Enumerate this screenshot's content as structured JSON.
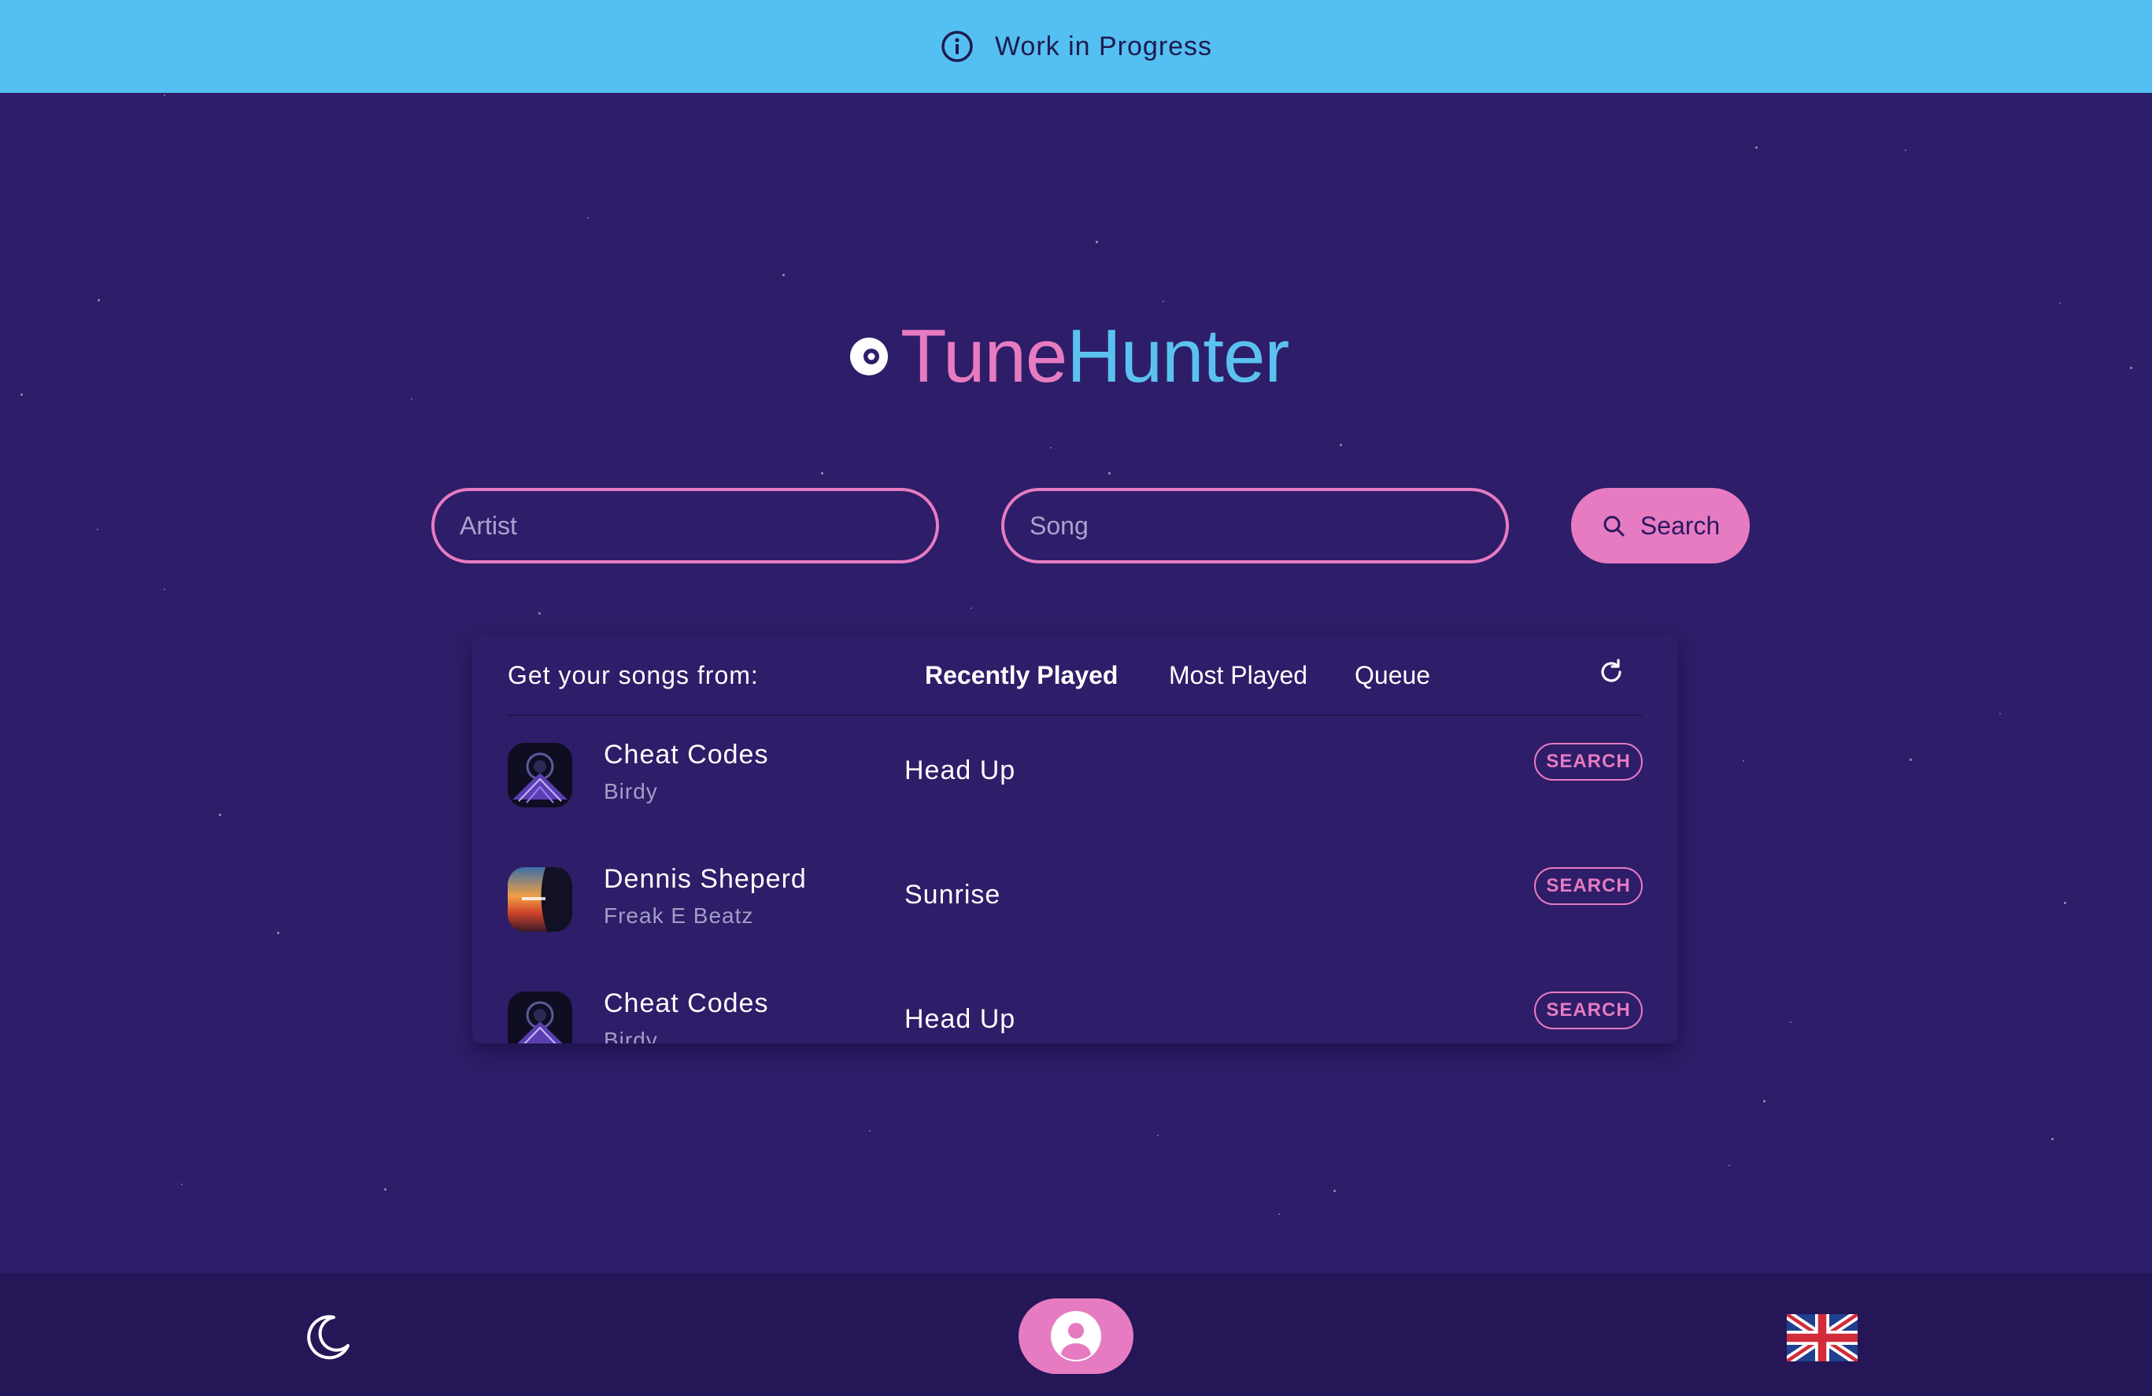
{
  "banner": {
    "text": "Work in Progress",
    "icon": "info-icon",
    "color": "#54c0f1"
  },
  "logo": {
    "title_part1": "Tune",
    "title_part2": "Hunter",
    "icon": "disc-icon"
  },
  "search": {
    "artist_placeholder": "Artist",
    "artist_value": "",
    "song_placeholder": "Song",
    "song_value": "",
    "button_label": "Search",
    "button_icon": "search-icon"
  },
  "panel": {
    "label": "Get your songs from:",
    "tabs": [
      {
        "label": "Recently Played",
        "active": true
      },
      {
        "label": "Most Played",
        "active": false
      },
      {
        "label": "Queue",
        "active": false
      }
    ],
    "refresh_icon": "refresh-icon",
    "rows": [
      {
        "artist": "Cheat Codes",
        "subtitle": "Birdy",
        "song": "Head Up",
        "button": "SEARCH"
      },
      {
        "artist": "Dennis Sheperd",
        "subtitle": "Freak E Beatz",
        "song": "Sunrise",
        "button": "SEARCH"
      },
      {
        "artist": "Cheat Codes",
        "subtitle": "Birdy",
        "song": "Head Up",
        "button": "SEARCH"
      }
    ]
  },
  "bottom": {
    "theme_icon": "moon-icon",
    "profile_icon": "user-icon",
    "language_icon": "uk-flag-icon"
  },
  "colors": {
    "background": "#2e1d68",
    "accent_pink": "#e67bc2",
    "accent_blue": "#5bc2f0",
    "bottom_bar": "#251657"
  }
}
